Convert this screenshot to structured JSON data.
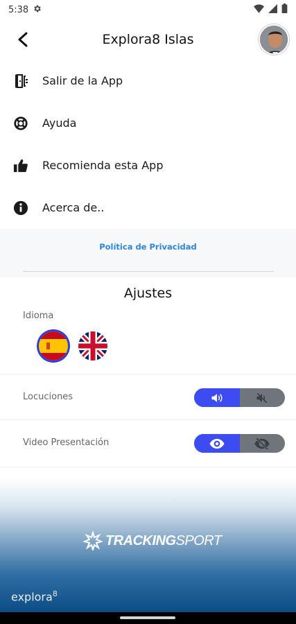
{
  "status_bar": {
    "time": "5:38"
  },
  "header": {
    "title": "Explora8 Islas"
  },
  "menu": [
    {
      "label": "Salir de la App",
      "icon": "exit-door-icon"
    },
    {
      "label": "Ayuda",
      "icon": "lifebuoy-icon"
    },
    {
      "label": "Recomienda esta App",
      "icon": "thumbs-up-icon"
    },
    {
      "label": "Acerca de..",
      "icon": "info-icon"
    }
  ],
  "privacy": {
    "link": "Política de Privacidad"
  },
  "settings": {
    "title": "Ajustes",
    "language_label": "Idioma",
    "selected_language": "es",
    "voice_label": "Locuciones",
    "voice_enabled": true,
    "video_label": "Video Presentación",
    "video_enabled": true
  },
  "footer": {
    "brand_bold": "TRACKING",
    "brand_light": "SPORT",
    "app_name": "explora",
    "app_sup": "8"
  },
  "colors": {
    "accent": "#3c4cf0",
    "toggle_off": "#70757c",
    "link": "#2f86d8",
    "footer_dark": "#0c4c85"
  }
}
